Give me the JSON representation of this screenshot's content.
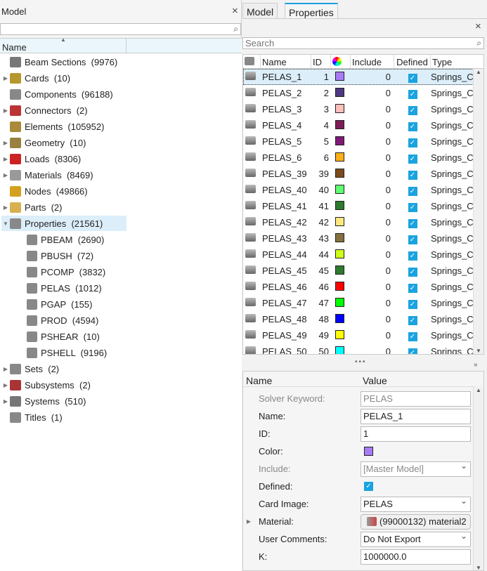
{
  "model_panel": {
    "title": "Model",
    "search_value": "",
    "column_name": "Name",
    "items": [
      {
        "label": "Beam Sections  (9976)",
        "expandable": false,
        "color": "#777"
      },
      {
        "label": "Cards  (10)",
        "expandable": true,
        "color": "#b8962e"
      },
      {
        "label": "Components  (96188)",
        "expandable": false,
        "color": "#888"
      },
      {
        "label": "Connectors  (2)",
        "expandable": true,
        "color": "#b33"
      },
      {
        "label": "Elements  (105952)",
        "expandable": false,
        "color": "#a88a3a"
      },
      {
        "label": "Geometry  (10)",
        "expandable": true,
        "color": "#9a8040"
      },
      {
        "label": "Loads  (8306)",
        "expandable": true,
        "color": "#c22"
      },
      {
        "label": "Materials  (8469)",
        "expandable": true,
        "color": "#999"
      },
      {
        "label": "Nodes  (49866)",
        "expandable": false,
        "color": "#d4a020"
      },
      {
        "label": "Parts  (2)",
        "expandable": true,
        "color": "#d8b050"
      },
      {
        "label": "Properties  (21561)",
        "expandable": true,
        "expanded": true,
        "selected": true,
        "color": "#888"
      },
      {
        "label": "PBEAM  (2690)",
        "child": true,
        "color": "#888"
      },
      {
        "label": "PBUSH  (72)",
        "child": true,
        "color": "#888"
      },
      {
        "label": "PCOMP  (3832)",
        "child": true,
        "color": "#888"
      },
      {
        "label": "PELAS  (1012)",
        "child": true,
        "color": "#888"
      },
      {
        "label": "PGAP  (155)",
        "child": true,
        "color": "#888"
      },
      {
        "label": "PROD  (4594)",
        "child": true,
        "color": "#888"
      },
      {
        "label": "PSHEAR  (10)",
        "child": true,
        "color": "#888"
      },
      {
        "label": "PSHELL  (9196)",
        "child": true,
        "color": "#888"
      },
      {
        "label": "Sets  (2)",
        "expandable": true,
        "color": "#888"
      },
      {
        "label": "Subsystems  (2)",
        "expandable": true,
        "color": "#a33"
      },
      {
        "label": "Systems  (510)",
        "expandable": true,
        "color": "#777"
      },
      {
        "label": "Titles  (1)",
        "expandable": false,
        "color": "#888"
      }
    ]
  },
  "tabs": [
    {
      "label": "Model"
    },
    {
      "label": "Properties",
      "active": true
    }
  ],
  "properties_panel": {
    "search_placeholder": "Search",
    "columns": [
      "Name",
      "ID",
      "Include",
      "Defined",
      "Type"
    ],
    "rows": [
      {
        "name": "PELAS_1",
        "id": "1",
        "color": "#a87cf8",
        "include": "0",
        "type": "Springs_C"
      },
      {
        "name": "PELAS_2",
        "id": "2",
        "color": "#4e3880",
        "include": "0",
        "type": "Springs_C"
      },
      {
        "name": "PELAS_3",
        "id": "3",
        "color": "#ffc0bc",
        "include": "0",
        "type": "Springs_C"
      },
      {
        "name": "PELAS_4",
        "id": "4",
        "color": "#7e1c58",
        "include": "0",
        "type": "Springs_C"
      },
      {
        "name": "PELAS_5",
        "id": "5",
        "color": "#801878",
        "include": "0",
        "type": "Springs_C"
      },
      {
        "name": "PELAS_6",
        "id": "6",
        "color": "#ffb018",
        "include": "0",
        "type": "Springs_C"
      },
      {
        "name": "PELAS_39",
        "id": "39",
        "color": "#7c4c1c",
        "include": "0",
        "type": "Springs_C"
      },
      {
        "name": "PELAS_40",
        "id": "40",
        "color": "#60ff70",
        "include": "0",
        "type": "Springs_C"
      },
      {
        "name": "PELAS_41",
        "id": "41",
        "color": "#2e7a2e",
        "include": "0",
        "type": "Springs_C"
      },
      {
        "name": "PELAS_42",
        "id": "42",
        "color": "#ffe880",
        "include": "0",
        "type": "Springs_C"
      },
      {
        "name": "PELAS_43",
        "id": "43",
        "color": "#857040",
        "include": "0",
        "type": "Springs_C"
      },
      {
        "name": "PELAS_44",
        "id": "44",
        "color": "#d0ff18",
        "include": "0",
        "type": "Springs_C"
      },
      {
        "name": "PELAS_45",
        "id": "45",
        "color": "#2e7a2e",
        "include": "0",
        "type": "Springs_C"
      },
      {
        "name": "PELAS_46",
        "id": "46",
        "color": "#ff0000",
        "include": "0",
        "type": "Springs_C"
      },
      {
        "name": "PELAS_47",
        "id": "47",
        "color": "#00ff00",
        "include": "0",
        "type": "Springs_C"
      },
      {
        "name": "PELAS_48",
        "id": "48",
        "color": "#0000ff",
        "include": "0",
        "type": "Springs_C"
      },
      {
        "name": "PELAS_49",
        "id": "49",
        "color": "#ffff00",
        "include": "0",
        "type": "Springs_C"
      },
      {
        "name": "PELAS_50",
        "id": "50",
        "color": "#00ffff",
        "include": "0",
        "type": "Springs_C"
      }
    ]
  },
  "entity_editor": {
    "col_name": "Name",
    "col_value": "Value",
    "rows": [
      {
        "label": "Solver Keyword:",
        "value": "PELAS",
        "kind": "text",
        "disabled": true
      },
      {
        "label": "Name:",
        "value": "PELAS_1",
        "kind": "text"
      },
      {
        "label": "ID:",
        "value": "1",
        "kind": "text"
      },
      {
        "label": "Color:",
        "kind": "color",
        "color": "#a87cf8"
      },
      {
        "label": "Include:",
        "value": "[Master Model]",
        "kind": "select",
        "disabled": true
      },
      {
        "label": "Defined:",
        "kind": "check"
      },
      {
        "label": "Card Image:",
        "value": "PELAS",
        "kind": "select"
      },
      {
        "label": "Material:",
        "value": "(99000132) material2",
        "kind": "button",
        "expandable": true
      },
      {
        "label": "User Comments:",
        "value": "Do Not Export",
        "kind": "select"
      },
      {
        "label": "K:",
        "value": "1000000.0",
        "kind": "text"
      }
    ]
  }
}
